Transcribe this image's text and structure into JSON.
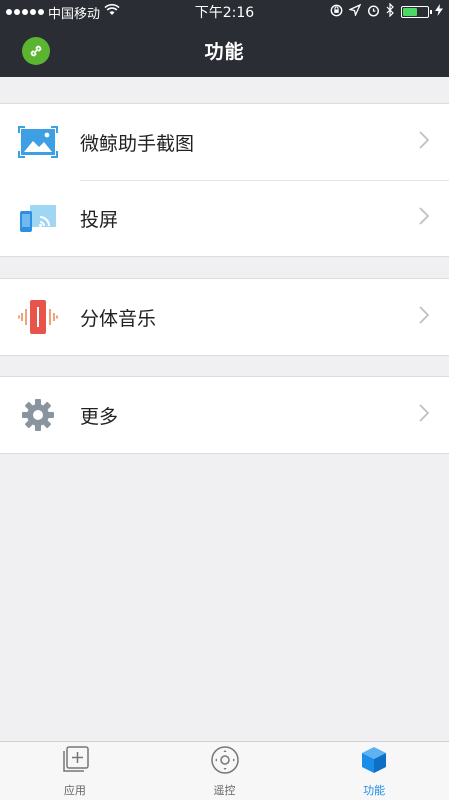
{
  "status_bar": {
    "carrier": "中国移动",
    "time": "下午2:16"
  },
  "nav": {
    "title": "功能"
  },
  "sections": [
    [
      {
        "label": "微鲸助手截图",
        "icon": "screenshot-icon"
      },
      {
        "label": "投屏",
        "icon": "cast-screen-icon"
      }
    ],
    [
      {
        "label": "分体音乐",
        "icon": "split-music-icon"
      }
    ],
    [
      {
        "label": "更多",
        "icon": "gear-icon"
      }
    ]
  ],
  "tabs": [
    {
      "label": "应用",
      "icon": "apps-icon",
      "active": false
    },
    {
      "label": "遥控",
      "icon": "remote-icon",
      "active": false
    },
    {
      "label": "功能",
      "icon": "cube-icon",
      "active": true
    }
  ],
  "colors": {
    "header_bg": "#2b2d34",
    "accent": "#1a8de8",
    "link_green": "#5cb531"
  }
}
